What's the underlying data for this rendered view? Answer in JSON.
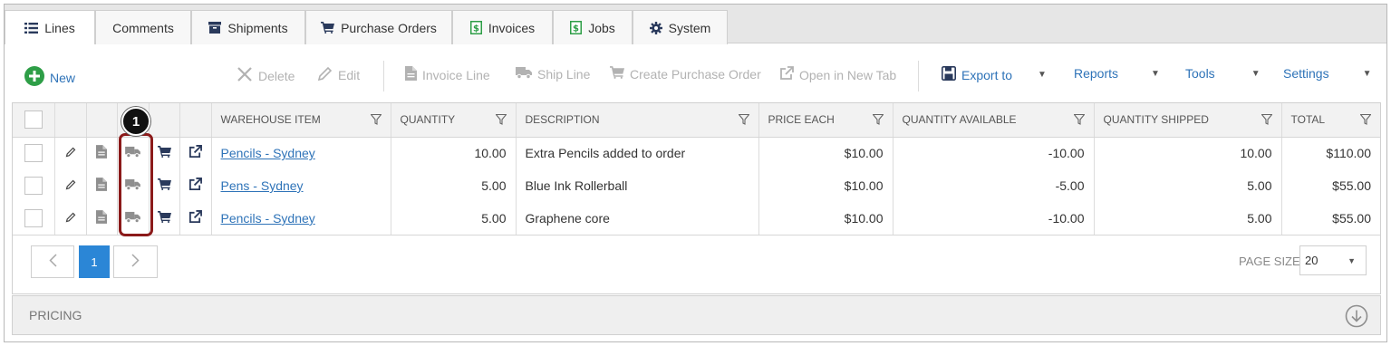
{
  "tabs": [
    {
      "label": "Lines",
      "icon": "list-icon"
    },
    {
      "label": "Comments",
      "icon": ""
    },
    {
      "label": "Shipments",
      "icon": "box-icon"
    },
    {
      "label": "Purchase Orders",
      "icon": "cart-icon"
    },
    {
      "label": "Invoices",
      "icon": "dollar-icon"
    },
    {
      "label": "Jobs",
      "icon": "dollar-icon"
    },
    {
      "label": "System",
      "icon": "gear-icon"
    }
  ],
  "toolbar": {
    "new": "New",
    "delete": "Delete",
    "edit": "Edit",
    "invoice_line": "Invoice Line",
    "ship_line": "Ship Line",
    "create_po": "Create Purchase Order",
    "open_tab": "Open in New Tab",
    "export": "Export to",
    "reports": "Reports",
    "tools": "Tools",
    "settings": "Settings"
  },
  "columns": {
    "warehouse_item": "WAREHOUSE ITEM",
    "quantity": "QUANTITY",
    "description": "DESCRIPTION",
    "price_each": "PRICE EACH",
    "qty_available": "QUANTITY AVAILABLE",
    "qty_shipped": "QUANTITY SHIPPED",
    "total": "TOTAL"
  },
  "rows": [
    {
      "item": "Pencils - Sydney",
      "quantity": "10.00",
      "description": "Extra Pencils added to order",
      "price": "$10.00",
      "available": "-10.00",
      "shipped": "10.00",
      "total": "$110.00"
    },
    {
      "item": "Pens - Sydney",
      "quantity": "5.00",
      "description": "Blue Ink Rollerball",
      "price": "$10.00",
      "available": "-5.00",
      "shipped": "5.00",
      "total": "$55.00"
    },
    {
      "item": "Pencils - Sydney",
      "quantity": "5.00",
      "description": "Graphene core",
      "price": "$10.00",
      "available": "-10.00",
      "shipped": "5.00",
      "total": "$55.00"
    }
  ],
  "pager": {
    "current_page": "1",
    "page_size_label": "PAGE SIZE",
    "page_size": "20"
  },
  "pricing": {
    "label": "PRICING"
  },
  "callout": {
    "number": "1"
  },
  "colors": {
    "accent": "#2e73b8",
    "new_green": "#2e9e47",
    "highlight": "#8b1a1a",
    "page_active": "#2b86d6"
  }
}
